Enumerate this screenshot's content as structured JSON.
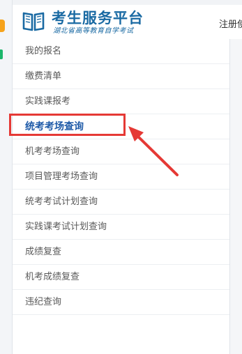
{
  "header": {
    "title": "考生服务平台",
    "subtitle": "湖北省高等教育自学考试",
    "register_link": "注册使"
  },
  "sidebar": {
    "items": [
      {
        "label": "我的报名",
        "active": false
      },
      {
        "label": "缴费清单",
        "active": false
      },
      {
        "label": "实践课报考",
        "active": false
      },
      {
        "label": "统考考场查询",
        "active": true
      },
      {
        "label": "机考考场查询",
        "active": false
      },
      {
        "label": "项目管理考场查询",
        "active": false
      },
      {
        "label": "统考考试计划查询",
        "active": false
      },
      {
        "label": "实践课考试计划查询",
        "active": false
      },
      {
        "label": "成绩复查",
        "active": false
      },
      {
        "label": "机考成绩复查",
        "active": false
      },
      {
        "label": "违纪查询",
        "active": false
      }
    ]
  },
  "colors": {
    "brand": "#1a6aa3",
    "active_text": "#1e5aa8",
    "annotation": "#e53935"
  },
  "icons": {
    "logo": "open-book-icon"
  }
}
